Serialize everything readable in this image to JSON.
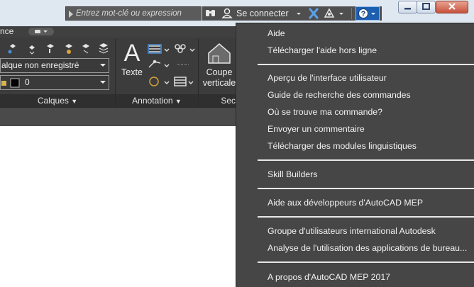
{
  "titlebar": {
    "search_placeholder": "Entrez mot-clé ou expression",
    "sign_in_label": "Se connecter"
  },
  "tabstrip": {
    "partial_tab": "nce"
  },
  "ribbon": {
    "layer_state_value": "alque non enregistré",
    "current_layer_value": "0",
    "text_button_label": "Texte",
    "section_button_line1": "Coupe",
    "section_button_line2": "verticale",
    "panels": {
      "calques": "Calques",
      "annotation": "Annotation",
      "section_partial": "Sec"
    }
  },
  "help_menu": {
    "items": [
      "Aide",
      "Télécharger l'aide hors ligne",
      "Aperçu de l'interface utilisateur",
      "Guide de recherche des commandes",
      "Où se trouve ma commande?",
      "Envoyer un commentaire",
      "Télécharger des modules linguistiques",
      "Skill Builders",
      "Aide aux développeurs d'AutoCAD MEP",
      "Groupe d'utilisateurs international Autodesk",
      "Analyse de l'utilisation des applications de bureau...",
      "A propos d'AutoCAD MEP 2017"
    ]
  },
  "colors": {
    "menu_bg": "#464646",
    "ribbon_bg": "#3c3c3c",
    "titlebar_bg": "#dfe7f1",
    "close_button": "#c6533b"
  }
}
